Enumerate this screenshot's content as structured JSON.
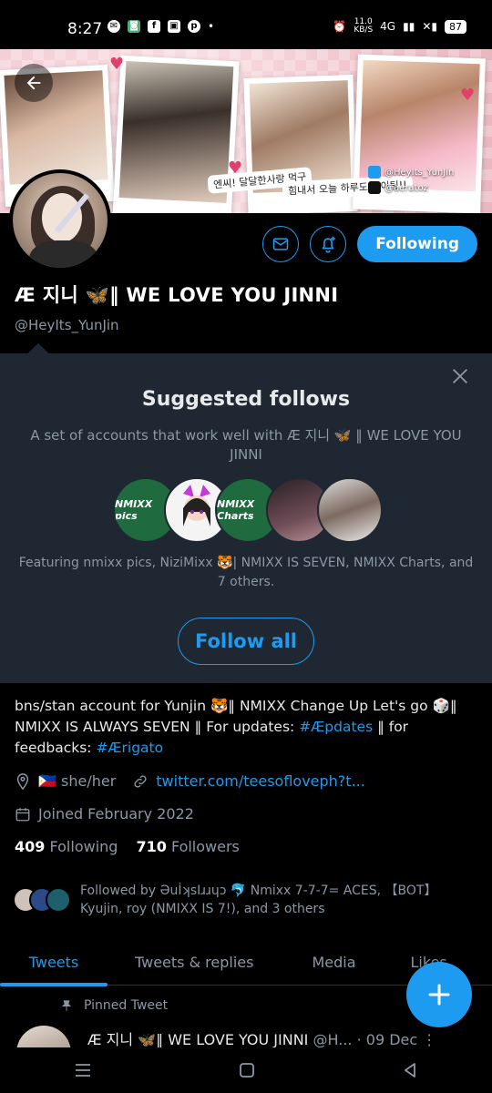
{
  "status_bar": {
    "time": "8:27",
    "speed_value": "11.0",
    "speed_unit": "KB/S",
    "network": "4G",
    "battery": "87"
  },
  "banner": {
    "caption_left": "엔씨! 달달한사랑 먹구",
    "caption_right": "힘내서 오늘 하루도 화이팅!!",
    "twitter_handle": "@HeyIts_YunJin",
    "tiktok_handle": "@aeratoz"
  },
  "profile": {
    "display_name": "Æ 지니 🦋‖ WE LOVE YOU JINNI",
    "handle": "@HeyIts_YunJin",
    "following_button": "Following"
  },
  "suggested": {
    "title": "Suggested follows",
    "subtitle": "A set of accounts that work well with Æ 지니 🦋 ‖ WE LOVE YOU JINNI",
    "avatar_labels": [
      "NMIXX pics",
      "",
      "NMIXX Charts",
      "",
      ""
    ],
    "featuring": "Featuring nmixx pics, NiziMixx 🐯| NMIXX IS SEVEN, NMIXX Charts, and 7 others.",
    "follow_all": "Follow all"
  },
  "bio": {
    "text_1": "bns/stan account for Yunjin 🐯‖ NMIXX Change Up Let's go 🎲‖ NMIXX IS ALWAYS SEVEN ‖  For updates: ",
    "tag_1": "#Æpdates",
    "text_2": " ‖ for feedbacks: ",
    "tag_2": "#Ærigato"
  },
  "meta": {
    "pronouns": "🇵🇭 she/her",
    "link": "twitter.com/teesofloveph?t...",
    "joined": "Joined February 2022"
  },
  "stats": {
    "following_count": "409",
    "following_label": "Following",
    "followers_count": "710",
    "followers_label": "Followers"
  },
  "followed_by": {
    "text": "Followed by ƏuİʞsIɹɹɥɔ 🐬 Nmixx 7-7-7= ACES, 【BOT】 Kyujin, roy (NMIXX IS 7!), and 3 others"
  },
  "tabs": [
    "Tweets",
    "Tweets & replies",
    "Media",
    "Likes"
  ],
  "pinned": {
    "label": "Pinned Tweet",
    "author": "Æ 지니 🦋‖ WE LOVE YOU JINNI",
    "handle": "@H...",
    "date": "· 09 Dec"
  },
  "colors": {
    "accent": "#1d9bf0",
    "background": "#000000",
    "panel": "#1e2732",
    "muted": "#8b98a5"
  },
  "icons": [
    "back-arrow-icon",
    "mail-icon",
    "bell-plus-icon",
    "close-icon",
    "location-icon",
    "link-icon",
    "calendar-icon",
    "pin-icon",
    "compose-plus-icon",
    "more-icon"
  ]
}
